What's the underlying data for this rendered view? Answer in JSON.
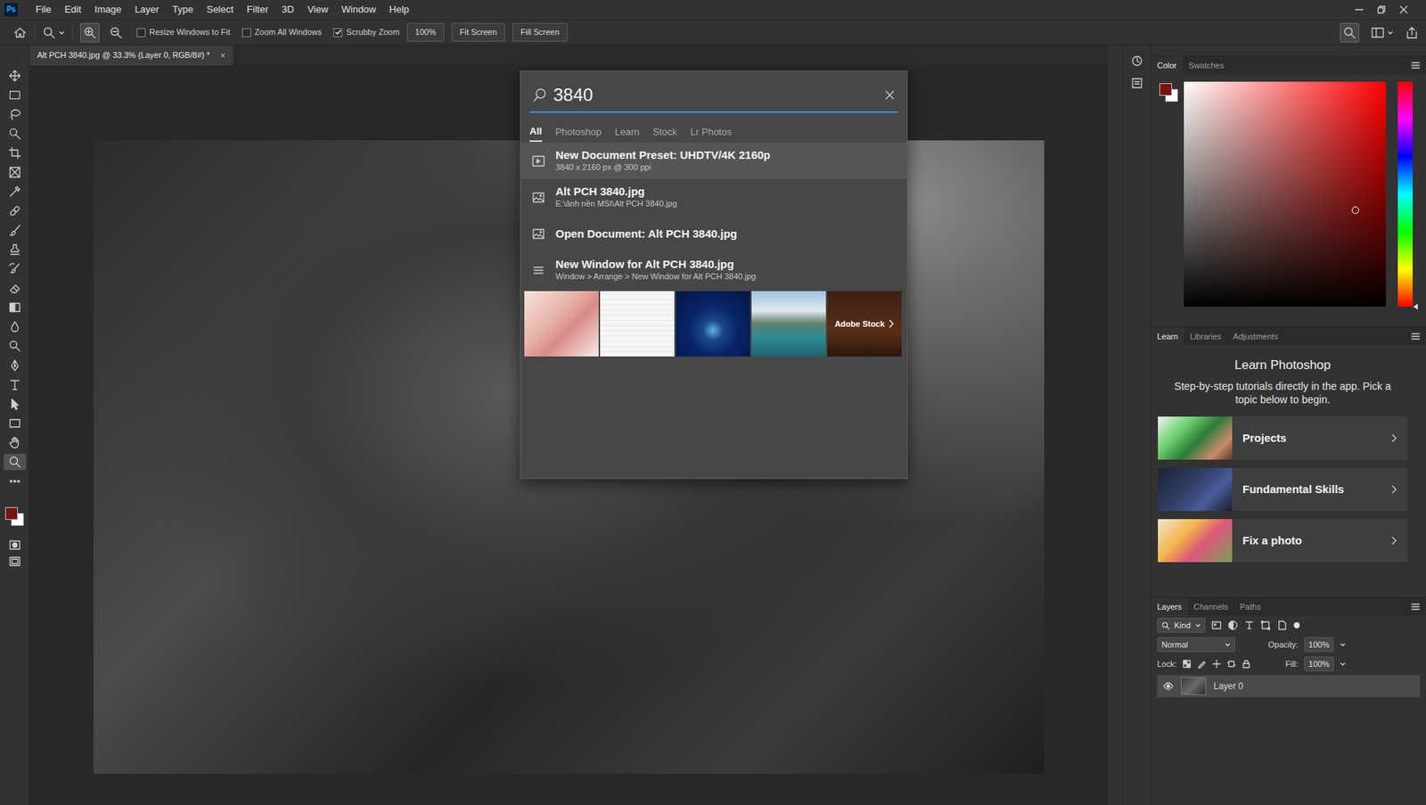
{
  "app": {
    "logo": "Ps"
  },
  "menu": [
    "File",
    "Edit",
    "Image",
    "Layer",
    "Type",
    "Select",
    "Filter",
    "3D",
    "View",
    "Window",
    "Help"
  ],
  "options": {
    "zoom_modes": [
      {
        "selected": true
      },
      {
        "selected": false
      }
    ],
    "checkboxes": [
      {
        "label": "Resize Windows to Fit",
        "checked": false
      },
      {
        "label": "Zoom All Windows",
        "checked": false
      },
      {
        "label": "Scrubby Zoom",
        "checked": true
      }
    ],
    "buttons": [
      "100%",
      "Fit Screen",
      "Fill Screen"
    ]
  },
  "document_tab": {
    "title": "Alt PCH 3840.jpg @ 33.3% (Layer 0, RGB/8#) *",
    "close": "×",
    "selected": true
  },
  "tools": [
    {
      "selected": false
    },
    {
      "selected": false
    },
    {
      "selected": false
    },
    {
      "selected": false
    },
    {
      "selected": false
    },
    {
      "selected": false
    },
    {
      "selected": false
    },
    {
      "selected": false
    },
    {
      "selected": false
    },
    {
      "selected": false
    },
    {
      "selected": false
    },
    {
      "selected": false
    },
    {
      "selected": false
    },
    {
      "selected": false
    },
    {
      "selected": false
    },
    {
      "selected": false
    },
    {
      "selected": false
    },
    {
      "selected": false
    },
    {
      "selected": false
    },
    {
      "selected": false
    },
    {
      "selected": true
    },
    {
      "selected": false
    }
  ],
  "color_panel": {
    "tabs": [
      {
        "label": "Color",
        "selected": true
      },
      {
        "label": "Swatches",
        "selected": false
      }
    ],
    "foreground": "#7a1411",
    "background": "#ffffff",
    "field_x": 0.85,
    "field_y": 0.57,
    "hue_level": 1.0
  },
  "learn_panel": {
    "tabs": [
      {
        "label": "Learn",
        "selected": true
      },
      {
        "label": "Libraries",
        "selected": false
      },
      {
        "label": "Adjustments",
        "selected": false
      }
    ],
    "title": "Learn Photoshop",
    "description": "Step-by-step tutorials directly in the app. Pick a topic below to begin.",
    "items": [
      "Projects",
      "Fundamental Skills",
      "Fix a photo"
    ]
  },
  "layers_panel": {
    "tabs": [
      {
        "label": "Layers",
        "selected": true
      },
      {
        "label": "Channels",
        "selected": false
      },
      {
        "label": "Paths",
        "selected": false
      }
    ],
    "filter": "Kind",
    "blend_mode": "Normal",
    "opacity_label": "Opacity:",
    "opacity": "100%",
    "lock_label": "Lock:",
    "fill_label": "Fill:",
    "fill": "100%",
    "layers": [
      {
        "name": "Layer 0",
        "visible": true,
        "selected": true
      }
    ]
  },
  "search": {
    "query": "3840",
    "tabs": [
      {
        "label": "All",
        "selected": true
      },
      {
        "label": "Photoshop",
        "selected": false
      },
      {
        "label": "Learn",
        "selected": false
      },
      {
        "label": "Stock",
        "selected": false
      },
      {
        "label": "Lr Photos",
        "selected": false
      }
    ],
    "results": [
      {
        "kind": "preset",
        "title": "New Document Preset: UHDTV/4K 2160p",
        "subtitle": "3840 x 2160 px @ 300 ppi",
        "selected": true
      },
      {
        "kind": "file",
        "title": "Alt PCH 3840.jpg",
        "subtitle": "E:\\ảnh nền MSI\\Alt PCH 3840.jpg",
        "selected": false
      },
      {
        "kind": "document",
        "title": "Open Document: Alt PCH 3840.jpg",
        "selected": false
      },
      {
        "kind": "menu",
        "title": "New Window for Alt PCH 3840.jpg",
        "subtitle": "Window > Arrange > New Window for Alt PCH 3840.jpg",
        "selected": false
      }
    ],
    "stock_label": "Adobe Stock"
  }
}
